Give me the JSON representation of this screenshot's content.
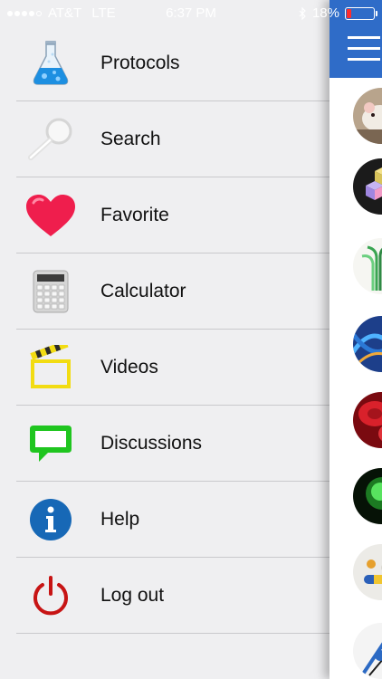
{
  "status_bar": {
    "carrier": "AT&T",
    "network": "LTE",
    "time": "6:37 PM",
    "battery": "18%",
    "battery_level": 0.18,
    "battery_color": "#ff2d2d"
  },
  "menu": {
    "items": [
      {
        "label": "Protocols",
        "icon": "flask-icon"
      },
      {
        "label": "Search",
        "icon": "magnifier-icon"
      },
      {
        "label": "Favorite",
        "icon": "heart-icon"
      },
      {
        "label": "Calculator",
        "icon": "calculator-icon"
      },
      {
        "label": "Videos",
        "icon": "clapperboard-icon"
      },
      {
        "label": "Discussions",
        "icon": "chat-bubble-icon"
      },
      {
        "label": "Help",
        "icon": "info-icon"
      },
      {
        "label": "Log out",
        "icon": "power-icon"
      }
    ]
  },
  "right_panel": {
    "header_color": "#2f6cc8",
    "menu_button_icon": "hamburger-icon",
    "thumbnails": [
      "lab-mouse-thumbnail",
      "molecule-cubes-thumbnail",
      "plant-seedling-thumbnail",
      "dna-strands-thumbnail",
      "red-blood-cells-thumbnail",
      "green-fluorescent-cell-thumbnail",
      "capsules-thumbnail",
      "lab-instrument-thumbnail"
    ]
  }
}
